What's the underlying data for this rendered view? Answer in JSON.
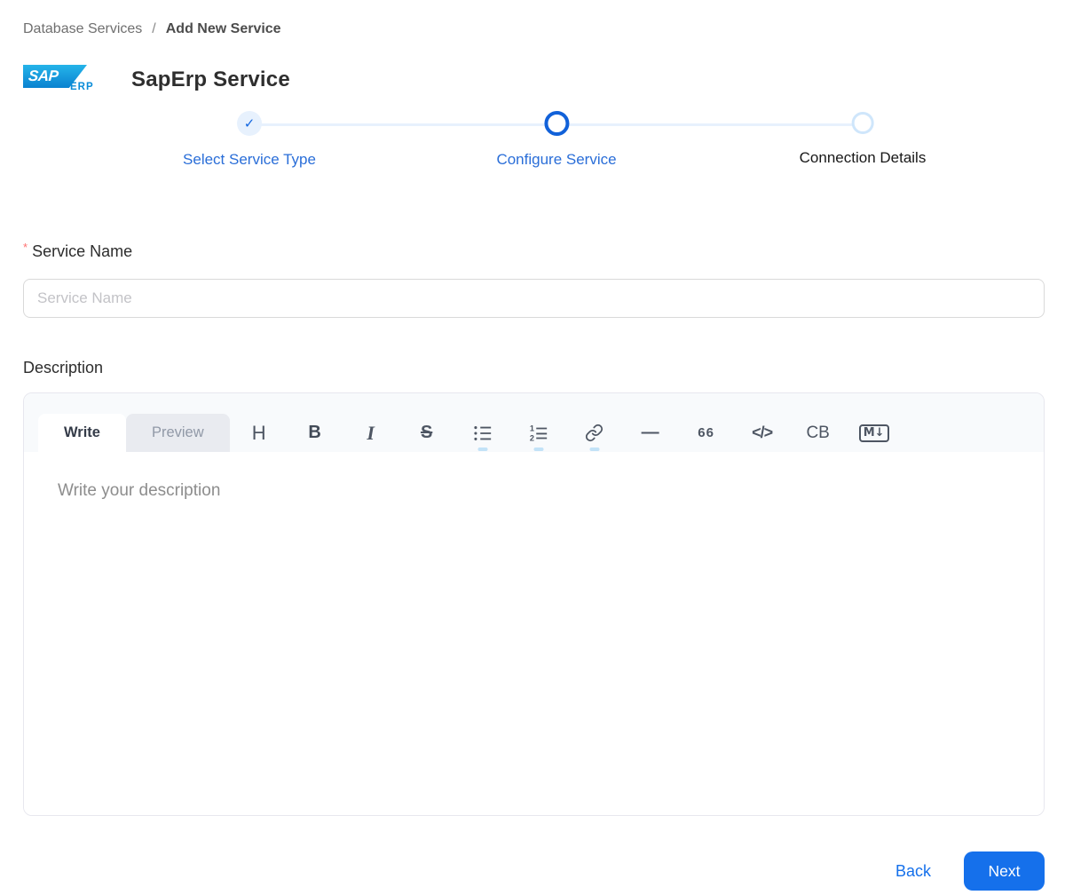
{
  "breadcrumb": {
    "parent": "Database Services",
    "separator": "/",
    "current": "Add New Service"
  },
  "header": {
    "logo_text": "SAP",
    "logo_sub": "ERP",
    "title": "SapErp Service"
  },
  "stepper": {
    "steps": [
      {
        "label": "Select Service Type",
        "state": "completed",
        "glyph": "✓"
      },
      {
        "label": "Configure Service",
        "state": "active"
      },
      {
        "label": "Connection Details",
        "state": "pending"
      }
    ]
  },
  "form": {
    "service_name": {
      "required_marker": "*",
      "label": "Service Name",
      "placeholder": "Service Name",
      "value": ""
    },
    "description": {
      "label": "Description",
      "editor": {
        "tabs": [
          {
            "label": "Write",
            "active": true
          },
          {
            "label": "Preview",
            "active": false
          }
        ],
        "toolbar": [
          {
            "name": "heading",
            "glyph": "H"
          },
          {
            "name": "bold",
            "glyph": "B"
          },
          {
            "name": "italic",
            "glyph": "I"
          },
          {
            "name": "strikethrough",
            "glyph": "S"
          },
          {
            "name": "bullet-list-icon",
            "glyph": ""
          },
          {
            "name": "ordered-list-icon",
            "glyph": ""
          },
          {
            "name": "link-icon",
            "glyph": ""
          },
          {
            "name": "horizontal-rule",
            "glyph": "—"
          },
          {
            "name": "quote",
            "glyph": "66"
          },
          {
            "name": "inline-code",
            "glyph": "</>"
          },
          {
            "name": "code-block",
            "glyph": "CB"
          },
          {
            "name": "markdown",
            "glyph": "M↓"
          }
        ],
        "placeholder": "Write your description",
        "value": ""
      }
    }
  },
  "footer": {
    "back_label": "Back",
    "next_label": "Next"
  },
  "colors": {
    "primary_blue": "#1570eb",
    "step_label_blue": "#2a6ed8",
    "step_track": "#e7f1fd",
    "sap_blue_top": "#25b4e9",
    "sap_blue_bottom": "#0a82d0",
    "required_red": "#ff7070"
  }
}
